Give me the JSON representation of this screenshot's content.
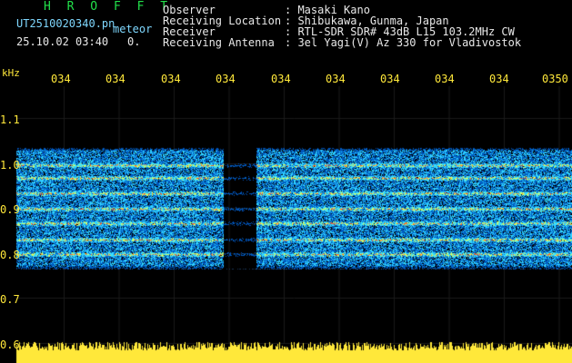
{
  "header": {
    "app_name": "H R O F F T",
    "file_name": "UT2510020340.pn",
    "mode_label": "meteor",
    "datetime": "25.10.02 03:40",
    "count": "0."
  },
  "info": {
    "labels": [
      "Observer",
      "Receiving Location",
      "Receiver",
      "Receiving Antenna"
    ],
    "values": [
      ": Masaki Kano",
      ": Shibukawa, Gunma, Japan",
      ": RTL-SDR SDR# 43dB L15 103.2MHz CW",
      ": 3el Yagi(V) Az 330 for Vladivostok"
    ]
  },
  "axis": {
    "y_unit": "kHz",
    "y_ticks": [
      "1.1",
      "1.0",
      "0.9",
      "0.8",
      "0.7",
      "0.6"
    ],
    "x_ticks": [
      "034",
      "034",
      "034",
      "034",
      "034",
      "034",
      "034",
      "034",
      "034",
      "0350"
    ]
  },
  "colors": {
    "background": "#000000",
    "header_green": "#22e04a",
    "info_cyan": "#7fd8ff",
    "axis_yellow": "#ffe83a"
  }
}
